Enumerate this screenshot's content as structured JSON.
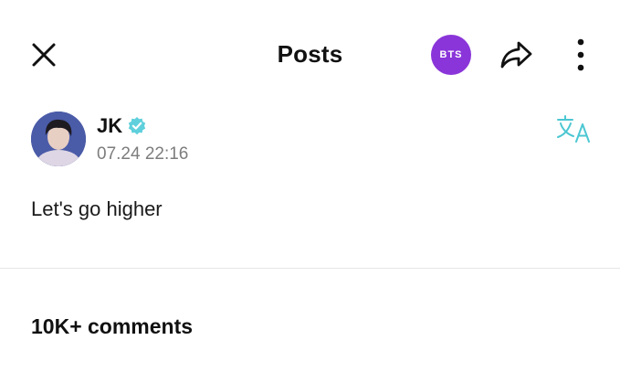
{
  "header": {
    "title": "Posts",
    "close_icon": "close-icon",
    "community_badge": "BTS",
    "community_badge_color": "#8a35d9",
    "share_icon": "share-icon",
    "more_icon": "more-vertical-icon"
  },
  "post": {
    "author": "JK",
    "verified": true,
    "verified_color": "#5fd0dc",
    "timestamp": "07.24 22:16",
    "translate_icon": "translate-icon",
    "translate_color": "#4cc7d2",
    "body": "Let's go higher"
  },
  "comments": {
    "heading": "10K+ comments"
  }
}
